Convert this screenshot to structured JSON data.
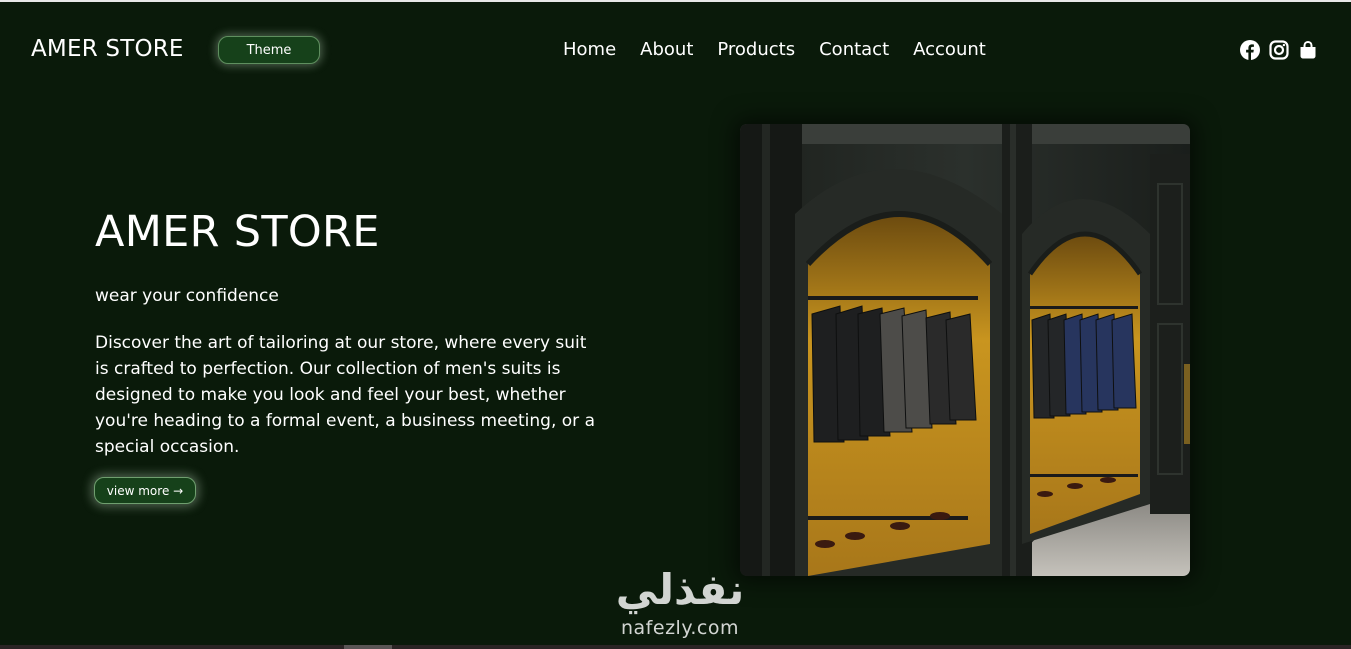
{
  "header": {
    "brand": "AMER STORE",
    "theme_label": "Theme",
    "nav": [
      "Home",
      "About",
      "Products",
      "Contact",
      "Account"
    ],
    "social_icons": [
      "facebook-icon",
      "instagram-icon",
      "shopping-bag-icon"
    ]
  },
  "hero": {
    "title": "AMER STORE",
    "tagline": "wear your confidence",
    "description": "Discover the art of tailoring at our store, where every suit is crafted to perfection. Our collection of men's suits is designed to make you look and feel your best, whether you're heading to a formal event, a business meeting, or a special occasion.",
    "cta_label": "view more →"
  },
  "watermark": {
    "arabic": "نفذلي",
    "latin": "nafezly.com"
  },
  "colors": {
    "background": "#0a1a0a",
    "button_bg": "#16411a",
    "accent_glow": "#c8e6c8",
    "text": "#ffffff",
    "alcove": "#c9951f"
  }
}
